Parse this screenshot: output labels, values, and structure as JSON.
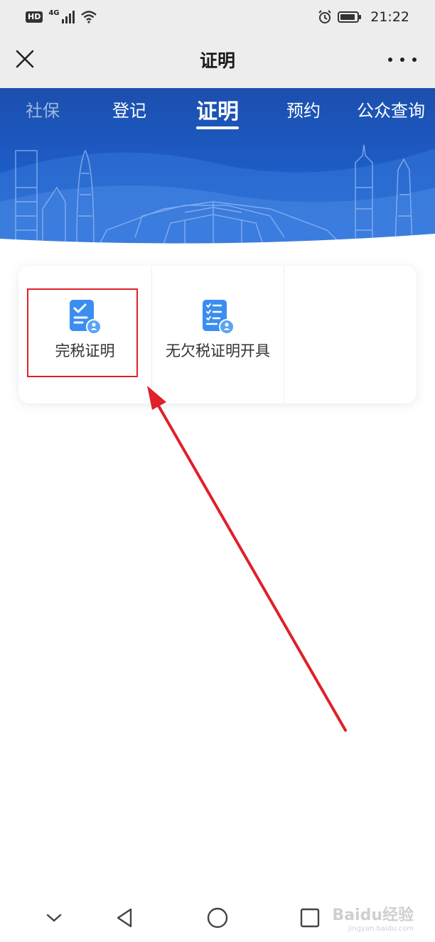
{
  "status_bar": {
    "hd": "HD",
    "network": "4G",
    "time": "21:22"
  },
  "header": {
    "title": "证明",
    "close_icon": "close-icon",
    "more_icon": "more-icon"
  },
  "tabs": [
    {
      "label": "社保"
    },
    {
      "label": "登记"
    },
    {
      "label": "证明",
      "active": true
    },
    {
      "label": "预约"
    },
    {
      "label": "公众查询"
    }
  ],
  "services": [
    {
      "label": "完税证明",
      "icon": "tax-paid-document-icon"
    },
    {
      "label": "无欠税证明开具",
      "icon": "no-arrears-document-icon"
    }
  ],
  "watermark": {
    "brand": "Baidu经验",
    "url": "jingyan.baidu.com"
  },
  "colors": {
    "banner_blue": "#1d5bc4",
    "icon_blue": "#3b8ef0",
    "highlight_red": "#e0202a"
  }
}
